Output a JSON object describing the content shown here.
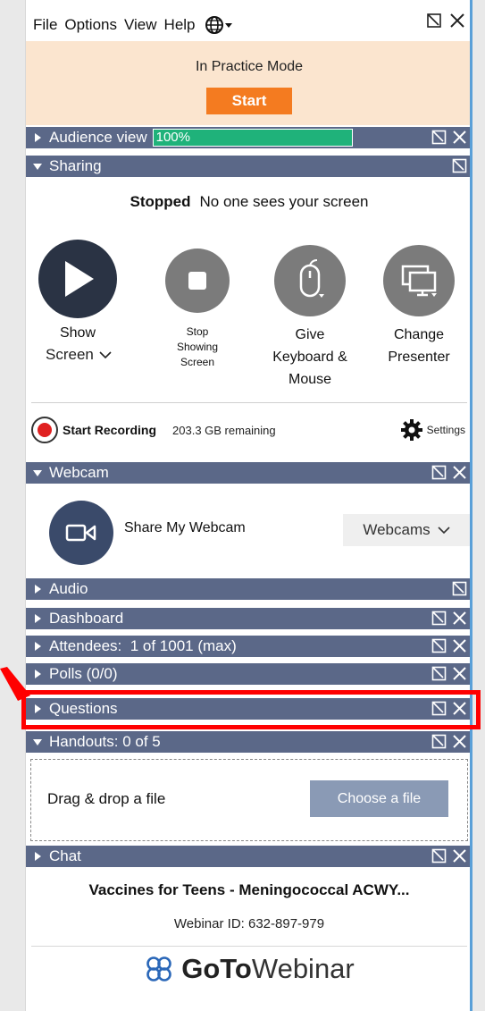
{
  "menu": {
    "items": [
      "File",
      "Options",
      "View",
      "Help"
    ],
    "globe_icon": "globe-icon"
  },
  "practice": {
    "label": "In Practice Mode",
    "start_label": "Start",
    "bg_color": "#fbe5cf",
    "button_color": "#f47b20"
  },
  "panes": {
    "audience": {
      "title": "Audience view",
      "progress_text": "100%",
      "progress": 1.0
    },
    "sharing": {
      "title": "Sharing"
    },
    "webcam": {
      "title": "Webcam"
    },
    "audio": {
      "title": "Audio"
    },
    "dashboard": {
      "title": "Dashboard"
    },
    "attendees": {
      "title": "Attendees:  1 of 1001 (max)"
    },
    "polls": {
      "title": "Polls (0/0)"
    },
    "questions": {
      "title": "Questions"
    },
    "handouts": {
      "title": "Handouts: 0 of 5"
    },
    "chat": {
      "title": "Chat"
    }
  },
  "sharing": {
    "status_bold": "Stopped",
    "status_text": "No one sees your screen",
    "show_label": "Show",
    "screen_select": "Screen",
    "stop_lines": [
      "Stop",
      "Showing",
      "Screen"
    ],
    "give_lines": [
      "Give",
      "Keyboard &",
      "Mouse"
    ],
    "change_lines": [
      "Change",
      "Presenter"
    ],
    "recording_label": "Start Recording",
    "remaining": "203.3 GB remaining",
    "settings_label": "Settings"
  },
  "webcam": {
    "share_label": "Share My Webcam",
    "select_label": "Webcams"
  },
  "handouts": {
    "drop_label": "Drag & drop a file",
    "choose_label": "Choose a file"
  },
  "footer": {
    "webinar_title": "Vaccines for Teens - Meningococcal ACWY...",
    "webinar_id": "Webinar ID: 632-897-979",
    "logo_bold": "GoTo",
    "logo_light": "Webinar"
  },
  "colors": {
    "pane_header": "#5b6888",
    "progress": "#1fb27a",
    "highlight": "#ff0000"
  }
}
